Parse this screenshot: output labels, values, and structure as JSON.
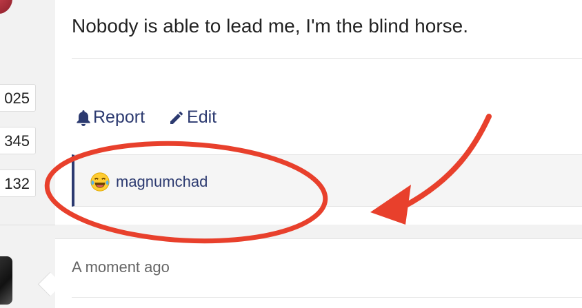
{
  "stats": [
    "025",
    "345",
    "132"
  ],
  "post": {
    "text": "Nobody is able to lead me, I'm the blind horse.",
    "actions": {
      "report_label": "Report",
      "edit_label": "Edit"
    }
  },
  "reply": {
    "username": "magnumchad",
    "emoji_icon": "laughing-crying-emoji"
  },
  "next_post": {
    "timestamp": "A moment ago"
  },
  "annotation": {
    "color": "#e8402c",
    "shapes": [
      "ellipse",
      "arrow"
    ]
  },
  "colors": {
    "link": "#2c3a70",
    "accent_border": "#2c3a70"
  }
}
